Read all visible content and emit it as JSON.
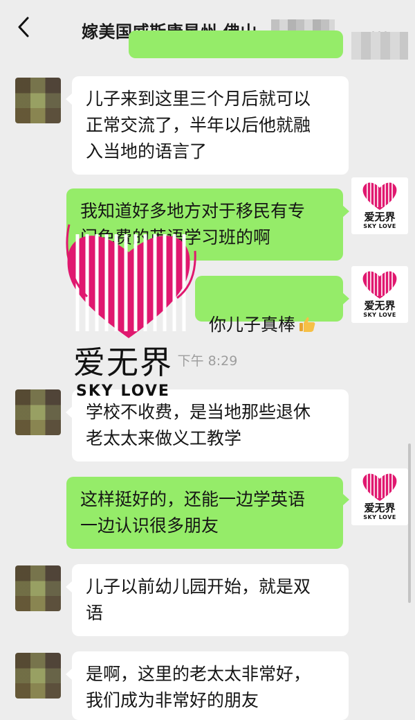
{
  "header": {
    "back_icon": "chevron-left-icon",
    "title": "嫁美国威斯康星州 佛山",
    "more_icon": "more-dots-icon",
    "more_label": "···"
  },
  "brand": {
    "name_cn": "爱无界",
    "name_en": "SKY LOVE",
    "accent_color": "#e0186f"
  },
  "timestamp": "下午 8:29",
  "messages": [
    {
      "side": "left",
      "text": "儿子来到这里三个月后就可以\n正常交流了，半年以后他就融\n入当地的语言了"
    },
    {
      "side": "right",
      "text": "我知道好多地方对于移民有专\n门免费的英语学习班的啊"
    },
    {
      "side": "right",
      "text": "你儿子真棒",
      "emoji": "thumbs-up"
    },
    {
      "side": "left",
      "text": "学校不收费，是当地那些退休\n老太太来做义工教学"
    },
    {
      "side": "right",
      "text": "这样挺好的，还能一边学英语\n一边认识很多朋友"
    },
    {
      "side": "left",
      "text": "儿子以前幼儿园开始，就是双\n语"
    },
    {
      "side": "left",
      "text": "是啊，这里的老太太非常好，\n我们成为非常好的朋友"
    }
  ],
  "colors": {
    "background": "#ededed",
    "bubble_self": "#95ec69",
    "bubble_other": "#ffffff",
    "timestamp_text": "#9d9d9d"
  }
}
